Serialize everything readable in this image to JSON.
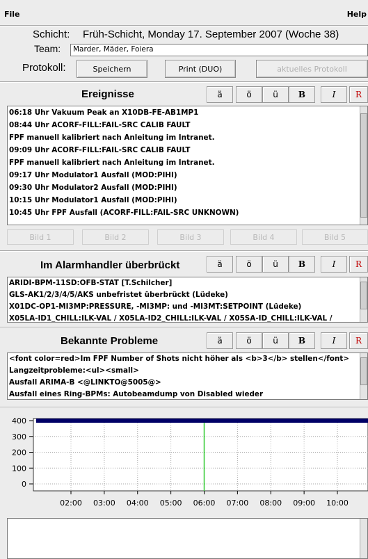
{
  "menu": {
    "file": "File",
    "help": "Help"
  },
  "header": {
    "schicht_label": "Schicht:",
    "schicht_value": "Früh-Schicht, Monday 17. September 2007 (Woche 38)",
    "team_label": "Team:",
    "team_value": "Marder, Mäder, Foiera",
    "protokoll_label": "Protokoll:",
    "save_label": "Speichern",
    "print_label": "Print (DUO)",
    "current_label": "aktuelles Protokoll"
  },
  "format_buttons": [
    "ä",
    "ö",
    "ü",
    "B",
    "I",
    "R"
  ],
  "ereignisse": {
    "title": "Ereignisse",
    "lines": [
      "06:18 Uhr Vakuum Peak an X10DB-FE-AB1MP1",
      "08:44 Uhr ACORF-FILL:FAIL-SRC CALIB FAULT",
      "FPF manuell kalibriert nach Anleitung im Intranet.",
      "09:09 Uhr ACORF-FILL:FAIL-SRC CALIB FAULT",
      "FPF manuell kalibriert nach Anleitung im Intranet.",
      "09:17 Uhr Modulator1 Ausfall (MOD:PIHI)",
      "09:30 Uhr Modulator2 Ausfall (MOD:PIHI)",
      "10:15 Uhr Modulator1 Ausfall (MOD:PIHI)",
      "10:45 Uhr FPF Ausfall (ACORF-FILL:FAIL-SRC  UNKNOWN)"
    ]
  },
  "bilder": [
    "Bild 1",
    "Bild 2",
    "Bild 3",
    "Bild 4",
    "Bild 5"
  ],
  "alarm": {
    "title": "Im Alarmhandler überbrückt",
    "lines": [
      "ARIDI-BPM-11SD:OFB-STAT [T.Schilcher]",
      "GLS-AK1/2/3/4/5/AKS unbefristet überbrückt (Lüdeke)",
      "X01DC-OP1-MI3MP:PRESSURE, -MI3MP: und -MI3MT:SETPOINT (Lüdeke)",
      "X05LA-ID1_CHILL:ILK-VAL / X05LA-ID2_CHILL:ILK-VAL / X05SA-ID_CHILL:ILK-VAL /"
    ]
  },
  "probleme": {
    "title": "Bekannte Probleme",
    "lines": [
      "<font color=red>Im FPF Number of Shots nicht höher als <b>3</b> stellen</font>",
      "Langzeitprobleme:<ul><small>",
      "Ausfall ARIMA-B <@LINKTO@5005@>",
      "Ausfall eines Ring-BPMs: Autobeamdump von Disabled wieder"
    ]
  },
  "chart_data": {
    "type": "line",
    "x_ticks": [
      "02:00",
      "03:00",
      "04:00",
      "05:00",
      "06:00",
      "07:00",
      "08:00",
      "09:00",
      "10:00"
    ],
    "y_ticks": [
      "400",
      "300",
      "200",
      "100",
      "0"
    ],
    "ylim": [
      0,
      400
    ],
    "series": [
      {
        "values": [
          400,
          400,
          400,
          400,
          400,
          400,
          400,
          400,
          400,
          400
        ],
        "color": "#000066"
      }
    ],
    "marker_time": "06:00",
    "marker_color": "#33cc33",
    "grid": true
  },
  "bottom": {
    "text": ""
  }
}
